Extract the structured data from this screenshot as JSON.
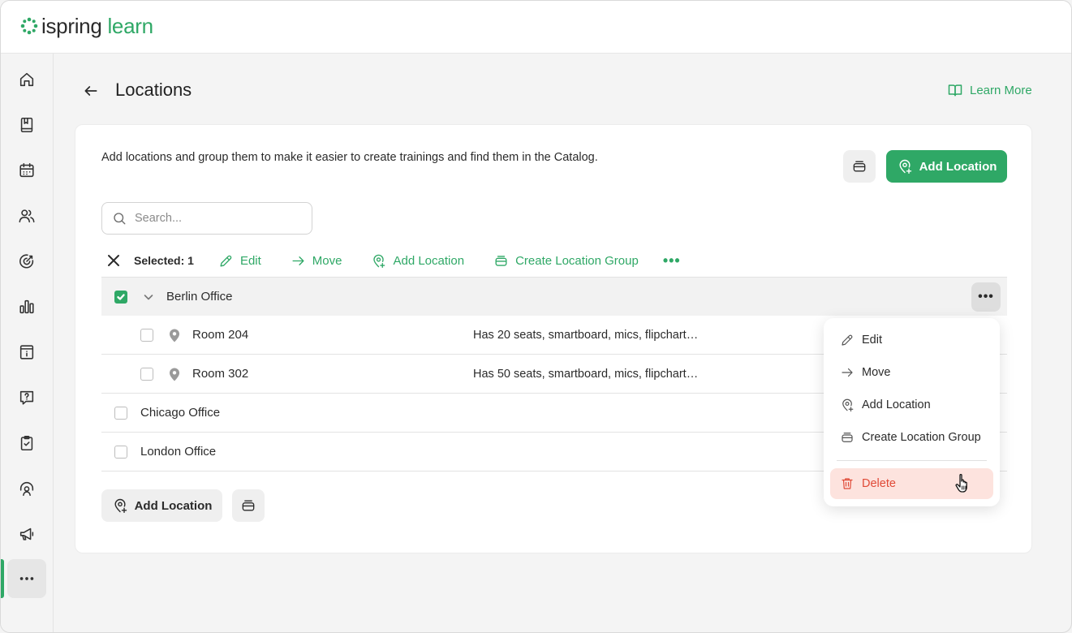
{
  "app": {
    "logo_part1": "ispring",
    "logo_part2": "learn",
    "brand_color": "#2fa866"
  },
  "sidebar": {
    "items": [
      {
        "name": "home-icon"
      },
      {
        "name": "book-icon"
      },
      {
        "name": "calendar-icon"
      },
      {
        "name": "users-icon"
      },
      {
        "name": "target-icon"
      },
      {
        "name": "bar-chart-icon"
      },
      {
        "name": "catalog-info-icon"
      },
      {
        "name": "question-icon"
      },
      {
        "name": "clipboard-check-icon"
      },
      {
        "name": "user-support-icon"
      },
      {
        "name": "megaphone-icon"
      },
      {
        "name": "more-icon",
        "active": true
      }
    ]
  },
  "header": {
    "title": "Locations",
    "learn_more": "Learn More"
  },
  "card": {
    "intro": "Add locations and group them to make it easier to create trainings and find them in the Catalog.",
    "add_location": "Add Location",
    "search_placeholder": "Search..."
  },
  "toolbar": {
    "selected": "Selected: 1",
    "edit": "Edit",
    "move": "Move",
    "add_location": "Add Location",
    "create_group": "Create Location Group",
    "more": "•••"
  },
  "table": {
    "rows": [
      {
        "type": "group",
        "label": "Berlin Office",
        "checked": true,
        "expanded": true
      },
      {
        "type": "location",
        "label": "Room 204",
        "description": "Has 20 seats, smartboard, mics, flipchart…"
      },
      {
        "type": "location",
        "label": "Room 302",
        "description": "Has 50 seats, smartboard, mics, flipchart…"
      },
      {
        "type": "group",
        "label": "Chicago Office",
        "checked": false
      },
      {
        "type": "group",
        "label": "London Office",
        "checked": false
      }
    ]
  },
  "bottom": {
    "add_location": "Add Location"
  },
  "context_menu": {
    "items": [
      {
        "label": "Edit",
        "icon": "pencil-icon"
      },
      {
        "label": "Move",
        "icon": "arrow-right-icon"
      },
      {
        "label": "Add Location",
        "icon": "pin-plus-icon"
      },
      {
        "label": "Create Location Group",
        "icon": "group-icon"
      },
      {
        "label": "Delete",
        "icon": "trash-icon",
        "danger_color": "#e04a37"
      }
    ]
  }
}
